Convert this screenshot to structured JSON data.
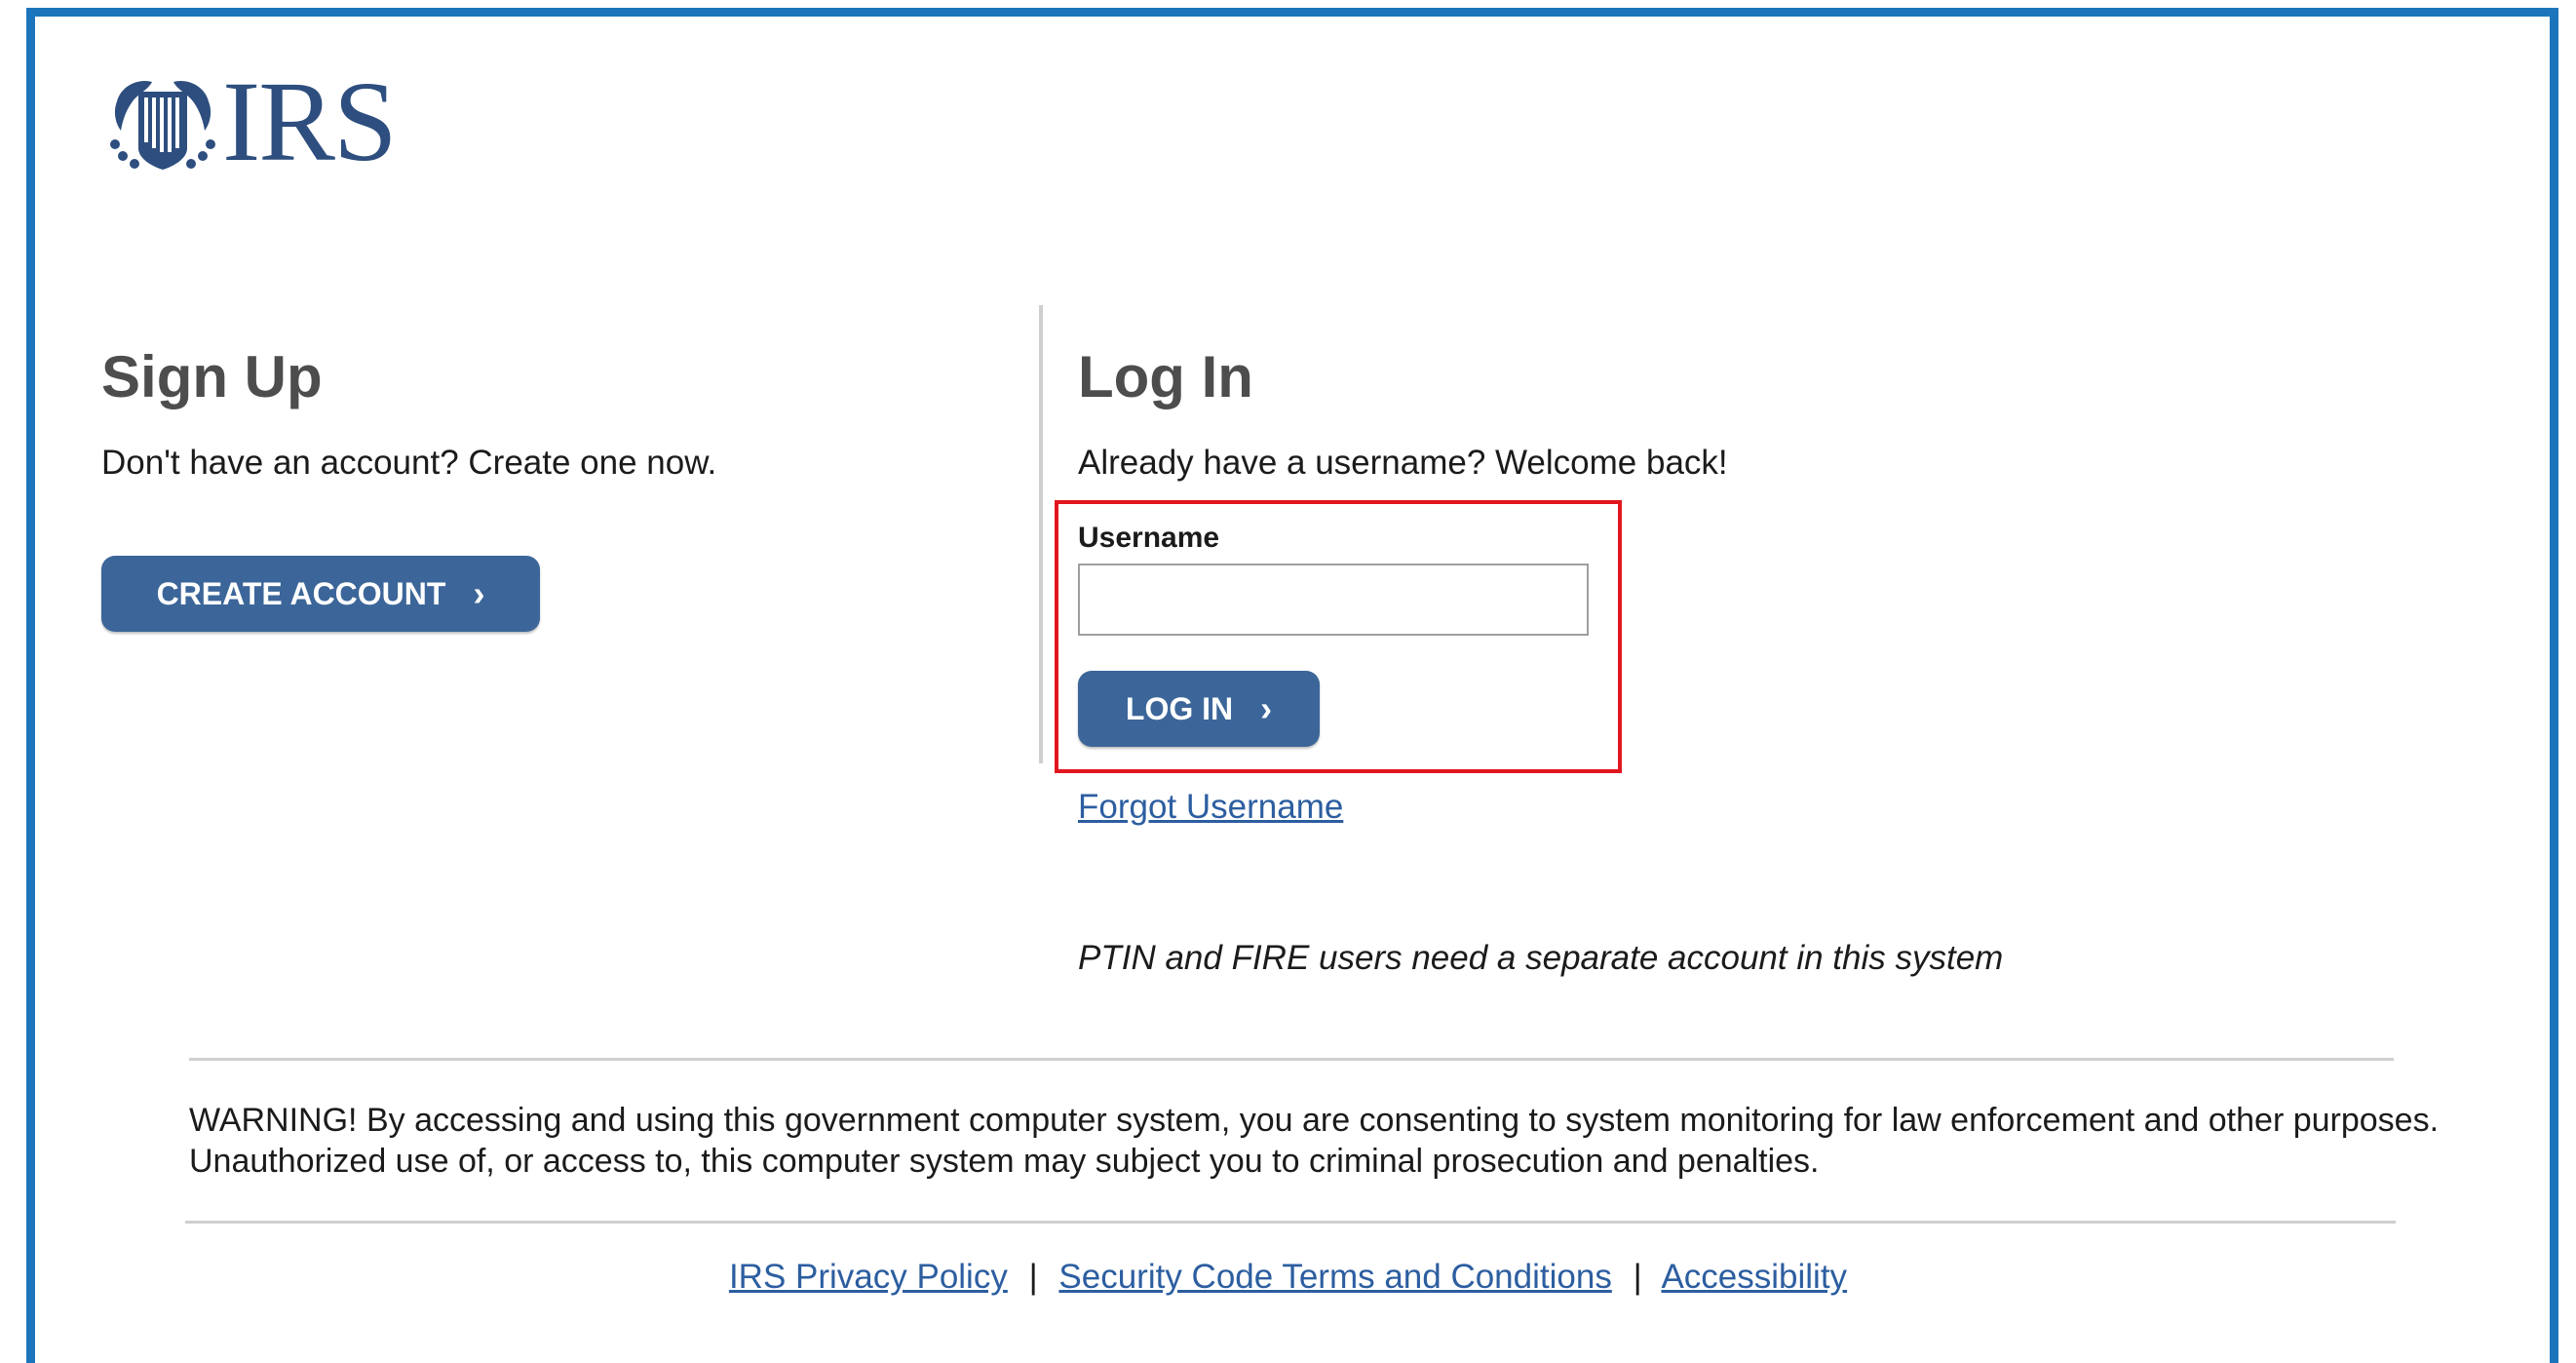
{
  "logo": {
    "wordmark": "IRS",
    "seal_icon": "irs-eagle-seal-icon",
    "color": "#2d4e7e"
  },
  "signup": {
    "title": "Sign Up",
    "subtitle": "Don't have an account? Create one now.",
    "button_label": "CREATE ACCOUNT",
    "button_icon": "chevron-right-icon"
  },
  "login": {
    "title": "Log In",
    "subtitle": "Already have a username? Welcome back!",
    "username_label": "Username",
    "username_value": "",
    "button_label": "LOG IN",
    "button_icon": "chevron-right-icon",
    "forgot_link": "Forgot Username",
    "note": "PTIN and FIRE users need a separate account in this system"
  },
  "warning": "WARNING! By accessing and using this government computer system, you are consenting to system monitoring for law enforcement and other purposes. Unauthorized use of, or access to, this computer system may subject you to criminal prosecution and penalties.",
  "footer": {
    "links": [
      "IRS Privacy Policy",
      "Security Code Terms and Conditions",
      "Accessibility"
    ],
    "separator": "|"
  },
  "colors": {
    "frame": "#1c75bc",
    "button": "#3c6699",
    "highlight": "#e2161f",
    "link": "#2c5ea0"
  }
}
